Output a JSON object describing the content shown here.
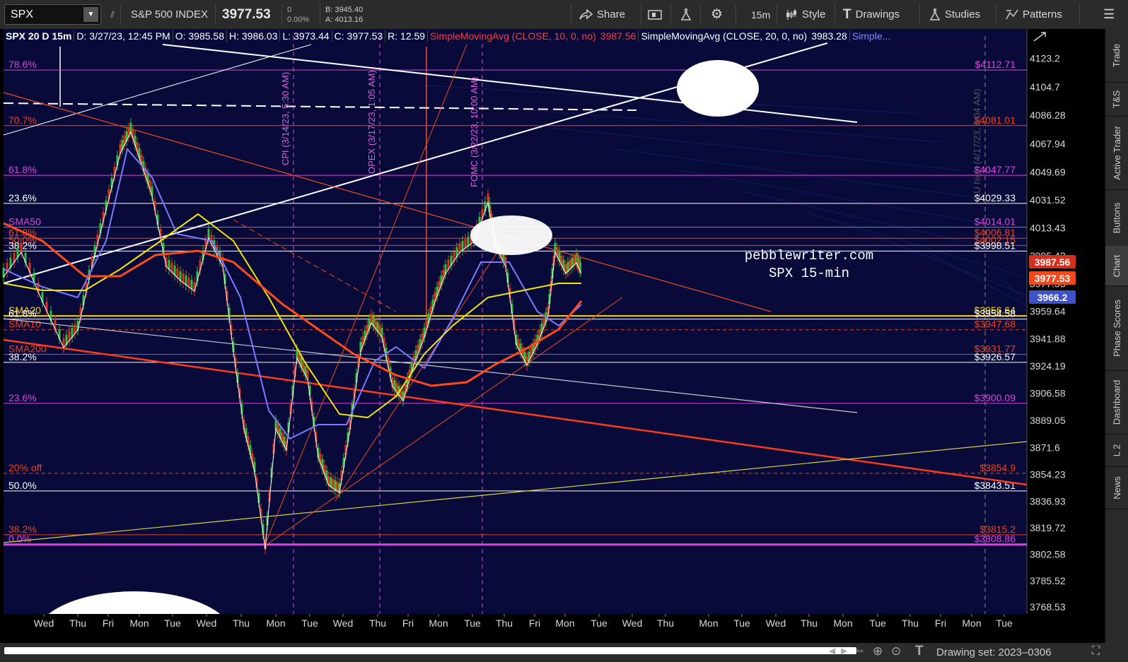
{
  "toolbar": {
    "symbol": "SPX",
    "index_name": "S&P 500 INDEX",
    "last_price": "3977.53",
    "change": "0",
    "change_pct": "0.00%",
    "bid": "B: 3945.40",
    "ask": "A: 4013.16",
    "share_label": "Share",
    "timeframe_label": "15m",
    "style_label": "Style",
    "drawings_label": "Drawings",
    "studies_label": "Studies",
    "patterns_label": "Patterns"
  },
  "info": {
    "title": "SPX 20 D 15m",
    "date": "D: 3/27/23, 12:45 PM",
    "open": "O: 3985.58",
    "high": "H: 3986.03",
    "low": "L: 3973.44",
    "close": "C: 3977.53",
    "range": "R: 12.59",
    "sma10": "SimpleMovingAvg (CLOSE, 10, 0, no)",
    "sma10_val": "3987.56",
    "sma20": "SimpleMovingAvg (CLOSE, 20, 0, no)",
    "sma20_val": "3983.28",
    "more": "Simple..."
  },
  "price_axis": [
    "4123.2",
    "4104.7",
    "4086.28",
    "4067.94",
    "4049.69",
    "4031.52",
    "4013.43",
    "3995.42",
    "3977.53",
    "3959.64",
    "3941.88",
    "3924.19",
    "3906.58",
    "3889.05",
    "3871.6",
    "3854.23",
    "3836.93",
    "3819.72",
    "3802.58",
    "3785.52",
    "3768.53"
  ],
  "price_badges": [
    {
      "text": "3987.56",
      "color": "#d62f1f"
    },
    {
      "text": "3977.53",
      "color": "#f04a1c"
    },
    {
      "text": "3966.2",
      "color": "#3f51c9"
    }
  ],
  "time_axis": [
    "Wed",
    "Thu",
    "Fri",
    "Mon",
    "Tue",
    "Wed",
    "Thu",
    "Mon",
    "Tue",
    "Wed",
    "Thu",
    "Fri",
    "Mon",
    "Tue",
    "Thu",
    "Fri",
    "Mon",
    "Tue",
    "Wed",
    "Thu",
    "Mon",
    "Tue",
    "Wed",
    "Thu",
    "Mon",
    "Tue",
    "Thu",
    "Fri",
    "Mon",
    "Tue"
  ],
  "fib_lines": [
    {
      "left": "78.6%",
      "right": "$4112.71",
      "color": "#e040e0",
      "price": 4115.5
    },
    {
      "left": "70.7%",
      "right": "$4081.01",
      "color": "#f0401a",
      "price": 4079.6
    },
    {
      "left": "61.8%",
      "right": "$4047.77",
      "color": "#e040e0",
      "price": 4047.5
    },
    {
      "left": "23.6%",
      "right": "$4029.33",
      "color": "#ffffff",
      "price": 4029.3
    },
    {
      "left": "SMA50",
      "right": "$4014.01",
      "color": "#e040e0",
      "price": 4014.0
    },
    {
      "left": "61.8%",
      "right": "$4006.81",
      "color": "#f0401a",
      "price": 4006.8
    },
    {
      "left": "50.0%",
      "right": "$4002.15",
      "color": "#f0401a",
      "price": 4002.15
    },
    {
      "left": "38.2%",
      "right": "$3998.51",
      "color": "#ffffff",
      "price": 3998.51
    },
    {
      "left": "SMA20",
      "right": "$3956.64",
      "color": "#ffd700",
      "price": 3956.6
    },
    {
      "left": "61.8%",
      "right": "$3954.58",
      "color": "#ffffff",
      "price": 3954.58
    },
    {
      "left": "SMA10",
      "right": "$3947.68",
      "color": "#f0401a",
      "price": 3947.68
    },
    {
      "left": "SMA200",
      "right": "$3931.77",
      "color": "#f0401a",
      "price": 3931.77
    },
    {
      "left": "38.2%",
      "right": "$3926.57",
      "color": "#ffffff",
      "price": 3926.57
    },
    {
      "left": "23.6%",
      "right": "$3900.09",
      "color": "#e040e0",
      "price": 3900.09
    },
    {
      "left": "20% off",
      "right": "$3854.9",
      "color": "#f0401a",
      "price": 3854.9
    },
    {
      "left": "50.0%",
      "right": "$3843.51",
      "color": "#ffffff",
      "price": 3843.51
    },
    {
      "left": "38.2%",
      "right": "$3815.2",
      "color": "#f0401a",
      "price": 3815.2
    },
    {
      "left": "0.0%",
      "right": "$3808.86",
      "color": "#e040e0",
      "price": 3808.86
    }
  ],
  "event_labels": [
    {
      "text": "CPI (3/14/23, 5:30 AM)"
    },
    {
      "text": "OPEX (3/17/23, 1:05 AM)"
    },
    {
      "text": "FOMC (3/22/23, 10:00 AM)"
    },
    {
      "text": "LU high (4/17/23, 8:04 AM)"
    }
  ],
  "watermark": {
    "line1": "pebblewriter.com",
    "line2": "SPX 15-min"
  },
  "side_tabs": [
    "Trade",
    "T&S",
    "Active Trader",
    "Buttons",
    "Chart",
    "Phase Scores",
    "Dashboard",
    "L 2",
    "News"
  ],
  "status": {
    "drawing_set": "Drawing set: 2023–0306"
  }
}
